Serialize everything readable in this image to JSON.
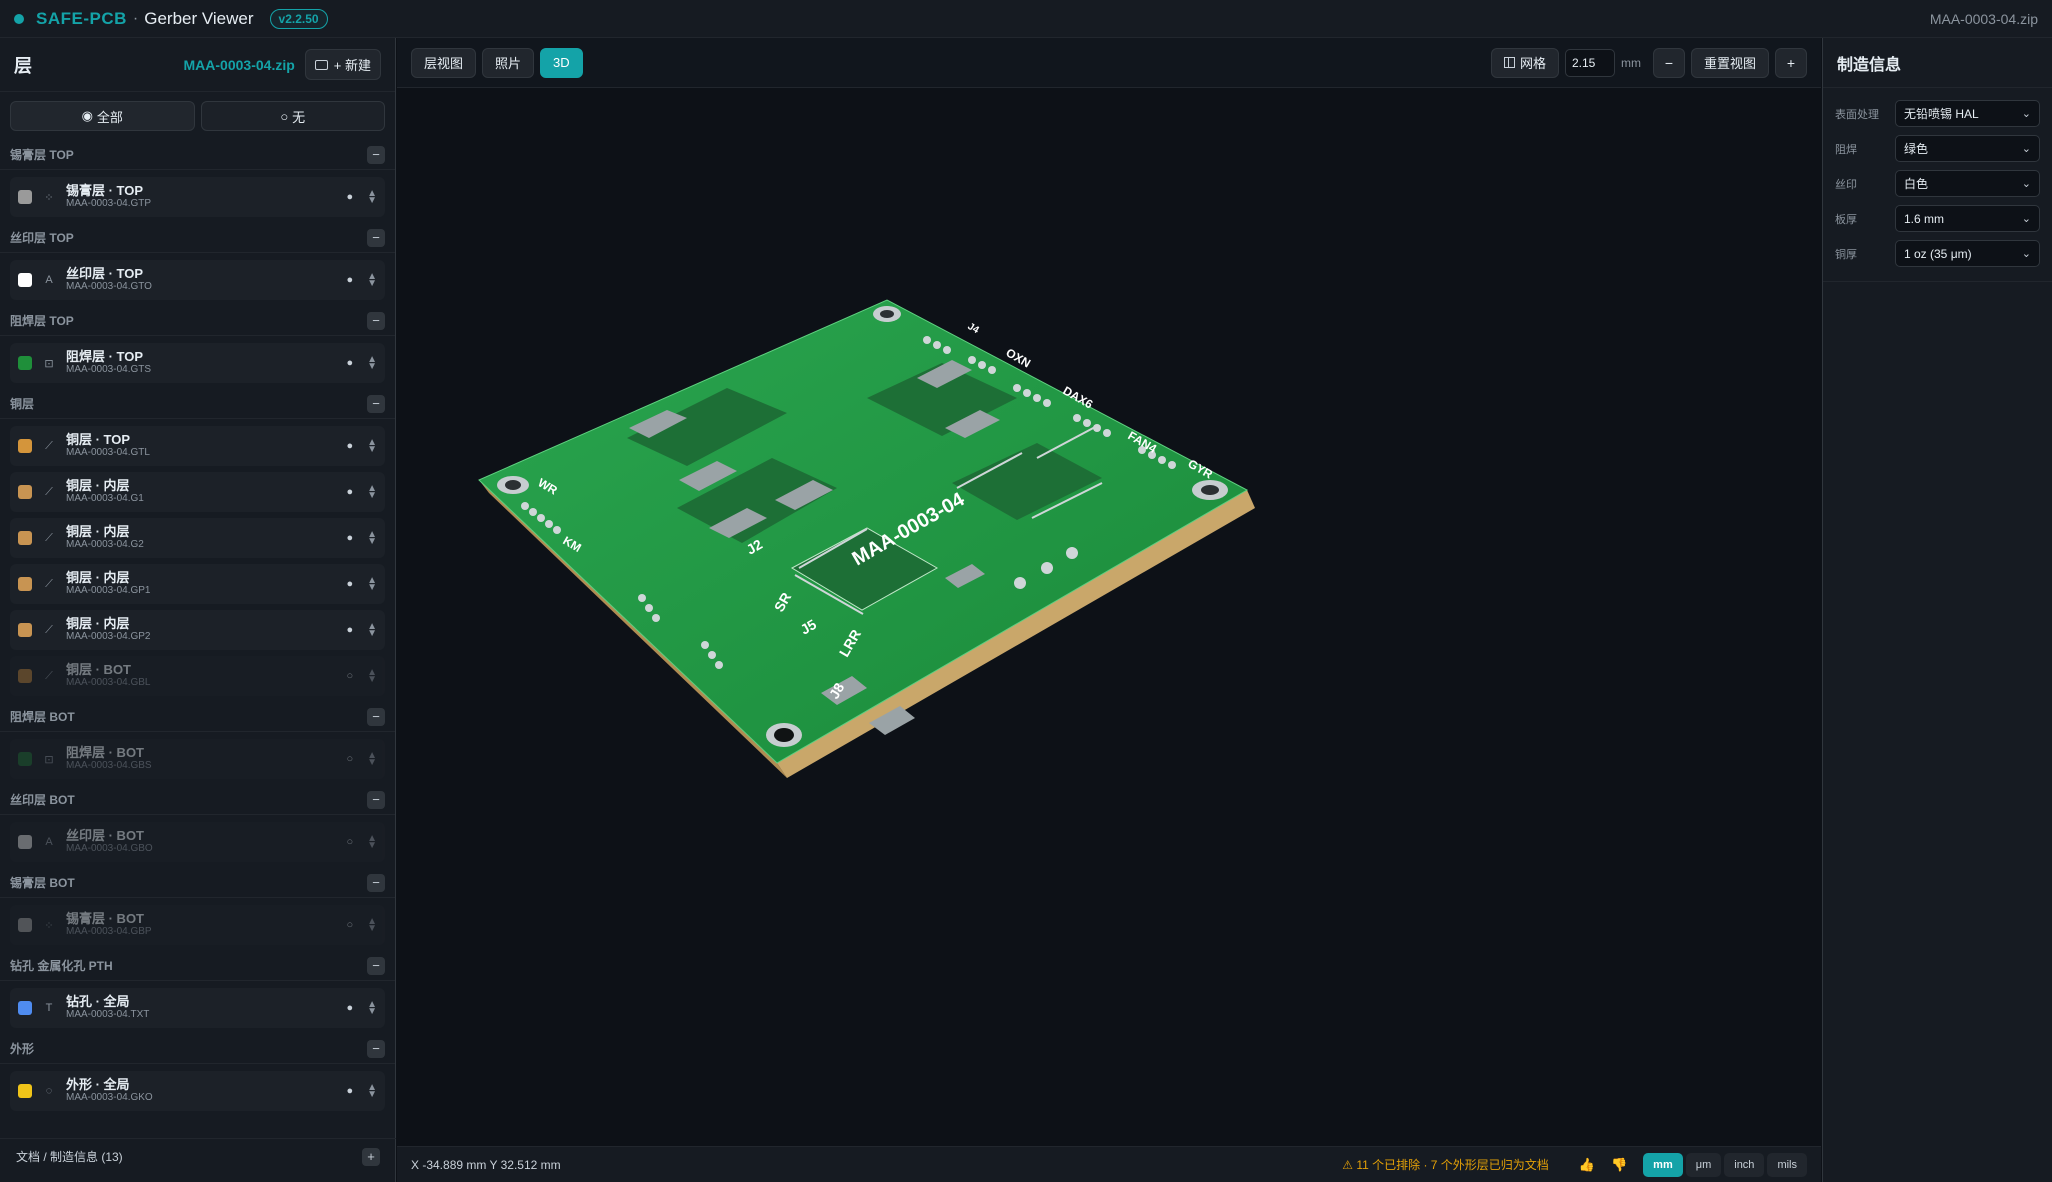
{
  "topbar": {
    "brand": "SAFE-PCB",
    "separator": "·",
    "subtitle": "Gerber Viewer",
    "version": "v2.2.50",
    "file": "MAA-0003-04.zip"
  },
  "left": {
    "title": "层",
    "zip": "MAA-0003-04.zip",
    "new_label": "+ 新建",
    "toggle_all": "全部",
    "toggle_none": "无",
    "groups": [
      {
        "title": "锡膏层 TOP",
        "layers": [
          {
            "name": "锡膏层 · TOP",
            "file": "MAA-0003-04.GTP",
            "color": "#9a9a9a",
            "type_icon": "⁘",
            "visible": true
          }
        ]
      },
      {
        "title": "丝印层 TOP",
        "layers": [
          {
            "name": "丝印层 · TOP",
            "file": "MAA-0003-04.GTO",
            "color": "#ffffff",
            "type_icon": "A",
            "visible": true
          }
        ]
      },
      {
        "title": "阻焊层 TOP",
        "layers": [
          {
            "name": "阻焊层 · TOP",
            "file": "MAA-0003-04.GTS",
            "color": "#1f8f3a",
            "type_icon": "⊡",
            "visible": true
          }
        ]
      },
      {
        "title": "铜层",
        "layers": [
          {
            "name": "铜层 · TOP",
            "file": "MAA-0003-04.GTL",
            "color": "#d4953b",
            "type_icon": "⟋",
            "visible": true
          },
          {
            "name": "铜层 · 内层",
            "file": "MAA-0003-04.G1",
            "color": "#c89452",
            "type_icon": "⟋",
            "visible": true
          },
          {
            "name": "铜层 · 内层",
            "file": "MAA-0003-04.G2",
            "color": "#c89452",
            "type_icon": "⟋",
            "visible": true
          },
          {
            "name": "铜层 · 内层",
            "file": "MAA-0003-04.GP1",
            "color": "#c89452",
            "type_icon": "⟋",
            "visible": true
          },
          {
            "name": "铜层 · 内层",
            "file": "MAA-0003-04.GP2",
            "color": "#c89452",
            "type_icon": "⟋",
            "visible": true
          },
          {
            "name": "铜层 · BOT",
            "file": "MAA-0003-04.GBL",
            "color": "#b07a3a",
            "type_icon": "⟋",
            "visible": false
          }
        ]
      },
      {
        "title": "阻焊层 BOT",
        "layers": [
          {
            "name": "阻焊层 · BOT",
            "file": "MAA-0003-04.GBS",
            "color": "#1f6a35",
            "type_icon": "⊡",
            "visible": false
          }
        ]
      },
      {
        "title": "丝印层 BOT",
        "layers": [
          {
            "name": "丝印层 · BOT",
            "file": "MAA-0003-04.GBO",
            "color": "#cfcfcf",
            "type_icon": "A",
            "visible": false
          }
        ]
      },
      {
        "title": "锡膏层 BOT",
        "layers": [
          {
            "name": "锡膏层 · BOT",
            "file": "MAA-0003-04.GBP",
            "color": "#9a9a9a",
            "type_icon": "⁘",
            "visible": false
          }
        ]
      },
      {
        "title": "钻孔 金属化孔 PTH",
        "layers": [
          {
            "name": "钻孔 · 全局",
            "file": "MAA-0003-04.TXT",
            "color": "#4f8cf0",
            "type_icon": "T",
            "visible": true
          }
        ]
      },
      {
        "title": "外形",
        "layers": [
          {
            "name": "外形 · 全局",
            "file": "MAA-0003-04.GKO",
            "color": "#f0c419",
            "type_icon": "◌",
            "visible": true
          }
        ]
      }
    ],
    "docs_label": "文档 / 制造信息 (13)"
  },
  "viewport": {
    "tabs": [
      "层视图",
      "照片",
      "3D"
    ],
    "active_tab": "3D",
    "grid_label": "网格",
    "grid_value": "2.15",
    "grid_unit": "mm",
    "minus": "−",
    "reset_label": "重置视图",
    "plus": "+",
    "board_labels": {
      "main": "MAA-0003-04",
      "j2": "J2",
      "j5": "J5",
      "j8": "J8",
      "sr": "SR",
      "wr": "WR",
      "fan": "FAN4",
      "dax": "DAX6",
      "gyr": "GYR",
      "oxn": "OXN",
      "j4": "J4",
      "lrr": "LRR",
      "km": "KM"
    },
    "coords": "X -34.889 mm Y 32.512 mm",
    "warning": "⚠ 11 个已排除 · 7 个外形层已归为文档",
    "units": [
      "mm",
      "μm",
      "inch",
      "mils"
    ],
    "active_unit": "mm"
  },
  "right": {
    "title": "制造信息",
    "props": [
      {
        "label": "表面处理",
        "value": "无铅喷锡 HAL"
      },
      {
        "label": "阻焊",
        "value": "绿色"
      },
      {
        "label": "丝印",
        "value": "白色"
      },
      {
        "label": "板厚",
        "value": "1.6 mm"
      },
      {
        "label": "铜厚",
        "value": "1 oz (35 μm)"
      }
    ]
  }
}
